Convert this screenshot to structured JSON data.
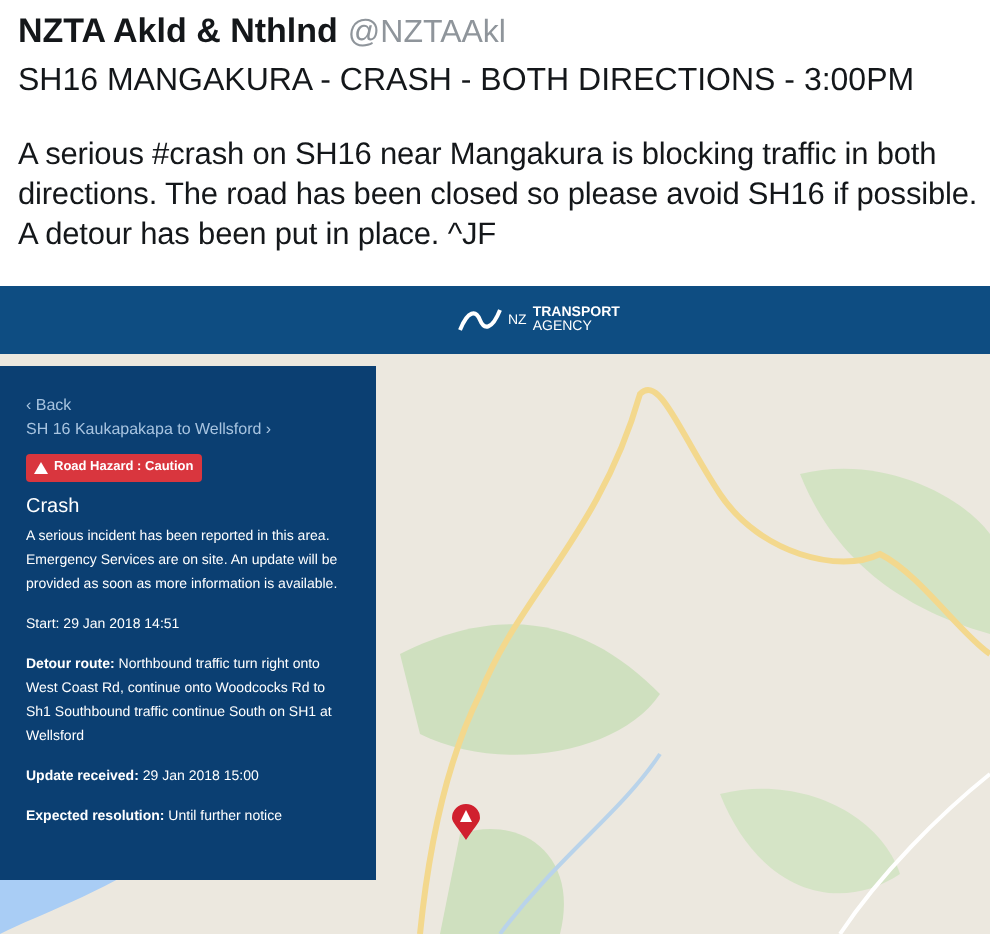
{
  "tweet": {
    "author": "NZTA Akld & Nthlnd",
    "handle": "@NZTAAkl",
    "headline": "SH16 MANGAKURA - CRASH - BOTH DIRECTIONS - 3:00PM",
    "body": "A serious #crash on SH16 near Mangakura is blocking traffic in both directions. The road has been closed so please avoid SH16 if possible. A detour has been put in place. ^JF"
  },
  "embed": {
    "logo": {
      "prefix": "NZ",
      "line_1": "TRANSPORT",
      "line_2": "AGENCY"
    },
    "panel": {
      "back": "‹ Back",
      "breadcrumb": "SH 16 Kaukapakapa to Wellsford ›",
      "badge": "Road Hazard : Caution",
      "title": "Crash",
      "description": "A serious incident has been reported in this area. Emergency Services are on site. An update will be provided as soon as more information is available.",
      "start": "Start: 29 Jan 2018 14:51",
      "fields": [
        {
          "label": "Detour route:",
          "value": "Northbound traffic turn right onto West Coast Rd, continue onto Woodcocks Rd to Sh1 Southbound traffic continue South on SH1 at Wellsford"
        },
        {
          "label": "Update received:",
          "value": "29 Jan 2018 15:00"
        },
        {
          "label": "Expected resolution:",
          "value": "Until further notice"
        }
      ]
    }
  }
}
